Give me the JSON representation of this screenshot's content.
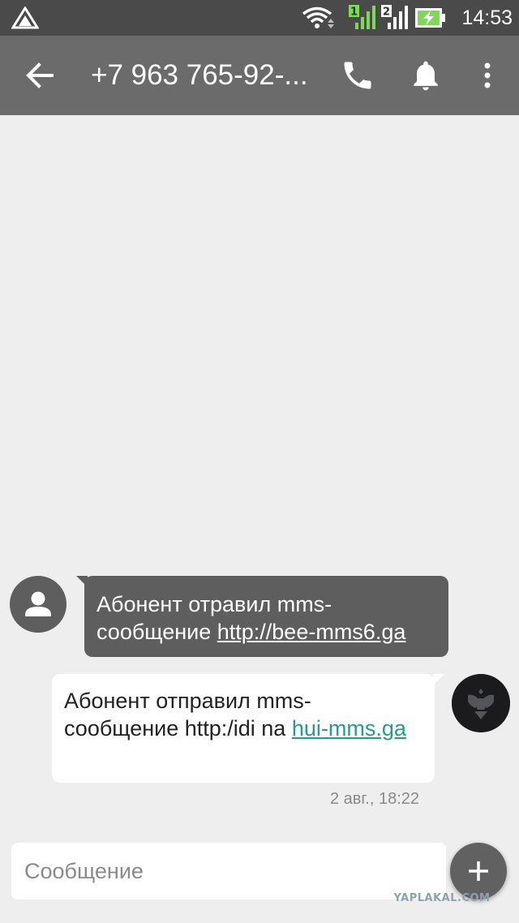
{
  "status_bar": {
    "sim1_label": "1",
    "sim2_label": "2",
    "time": "14:53"
  },
  "toolbar": {
    "title": "+7 963 765-92-..."
  },
  "messages": [
    {
      "direction": "incoming",
      "text_before_link": "Абонент отравил mms-сообщение ",
      "link": "http://bee-mms6.ga"
    },
    {
      "direction": "outgoing",
      "text_before_link": "Абонент отправил mms-сообщение  http:/idi na ",
      "link": "hui-mms.ga",
      "timestamp": "2 авг., 18:22"
    }
  ],
  "composer": {
    "placeholder": "Сообщение"
  },
  "watermark": "YAPLAKAL.COM",
  "icons": {
    "notification": "warning-triangle-icon",
    "wifi": "wifi-icon",
    "signal": "cell-signal-icon",
    "battery": "battery-charging-icon",
    "back": "arrow-back-icon",
    "call": "phone-icon",
    "notify": "bell-icon",
    "menu": "more-vert-icon",
    "contact": "person-icon",
    "attach": "plus-icon"
  },
  "colors": {
    "status_bar": "#4a4a4a",
    "toolbar": "#6b6b6b",
    "background": "#eeeeee",
    "incoming_bubble": "#5e5e5e",
    "outgoing_bubble": "#ffffff",
    "link_outgoing": "#1f9e94",
    "signal_sim1": "#7ed957"
  }
}
